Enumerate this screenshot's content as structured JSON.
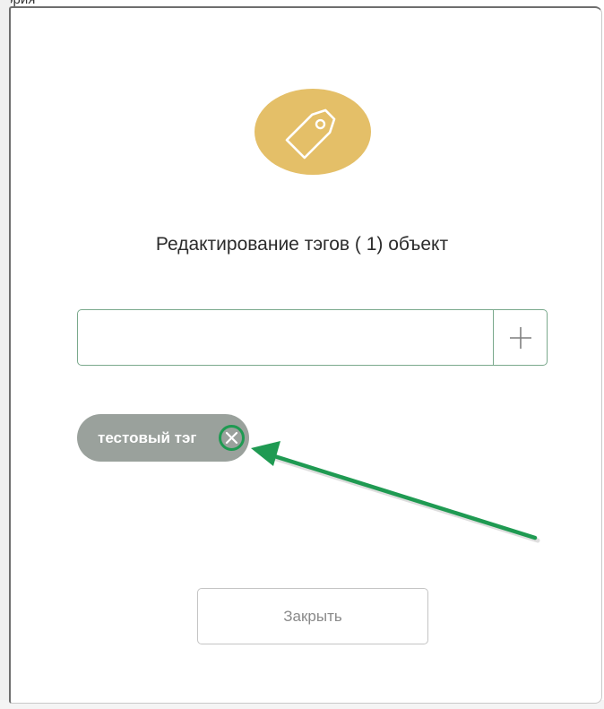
{
  "background": {
    "cut_text": "тэрия"
  },
  "dialog": {
    "icon": "tag-icon",
    "icon_circle_color": "#e4bf68",
    "title": "Редактирование тэгов ( 1) объект",
    "tag_input": {
      "value": "",
      "placeholder": ""
    },
    "add_button": {
      "icon": "plus-icon"
    },
    "tags": [
      {
        "label": "тестовый тэг",
        "remove_icon": "close-circle-icon"
      }
    ],
    "close_button_label": "Закрыть"
  },
  "annotation": {
    "type": "arrow",
    "color": "#1f9a52",
    "points_to": "tag-remove-button"
  }
}
